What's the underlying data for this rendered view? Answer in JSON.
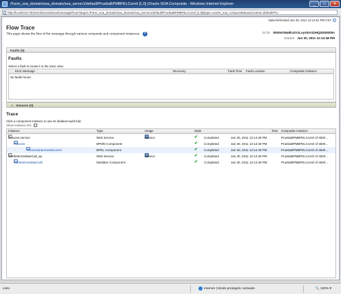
{
  "window": {
    "title": "/Farm_soa_domain/soa_domain/soa_server1/default/PruebaBPMBPELCorrel [1.0] (Oracle SOA Composite - Windows Internet Explorer",
    "minimize": "_",
    "maximize": "□",
    "close": "✕"
  },
  "address": {
    "url": "http://localhost:7001/em/faces/ai/soa/messageFlow?target=/Farm_soa_domain/soa_domain/soa_server1/default/PruebaBPMBPELCorrel [1.0]&type=oracle_soa_composite&soaContext=default/Pru"
  },
  "header": {
    "refresh_label": "Data Refreshed Jan 30, 2011 12:14:51 PM CST",
    "title": "Flow Trace",
    "description": "This page shows the flow of the message through various composite and component instances.",
    "help": "?",
    "ecid_label": "ECID",
    "ecid_value": "0000IrO8a8hJ4YzLoyG0A1DHQ2D00000n",
    "started_label": "Started",
    "started_value": "Jan 30, 2011 12:14:48 PM"
  },
  "faults": {
    "bar_label": "Faults (0)",
    "heading": "Faults",
    "hint": "Select a fault to locate it in the trace view.",
    "columns": [
      "Error Message",
      "Recovery",
      "Fault Time",
      "Fault Location",
      "Composite Instance"
    ],
    "empty": "No faults found"
  },
  "sensors": {
    "bar_label": "Sensors (0)"
  },
  "trace": {
    "heading": "Trace",
    "hint": "Click a component instance to see its detailed audit trail.",
    "show_ids": "Show Instance IDs",
    "columns": [
      "Instance",
      "Type",
      "Usage",
      "State",
      "Time",
      "Composite Instance"
    ],
    "rows": [
      {
        "instance": "Process.service",
        "type": "Web Service",
        "usage": "Service",
        "state": "Completed",
        "time": "Jan 30, 2011 12:14:48 PM",
        "composite": "PruebaBPMBPELCorrel of 4500..."
      },
      {
        "instance": "Process",
        "type": "BPMN Component",
        "usage": "",
        "state": "Completed",
        "time": "Jan 30, 2011 12:14:49 PM",
        "composite": "PruebaBPMBPELCorrel of 4500..."
      },
      {
        "instance": "*ProcessIntermedioCorrel",
        "type": "BPEL Component",
        "usage": "",
        "state": "Completed",
        "time": "Jan 30, 2011 12:14:49 PM",
        "composite": "PruebaBPMBPELCorrel of 4500..."
      },
      {
        "instance": "MedIntermediateCall_ep",
        "type": "Web Service",
        "usage": "Service",
        "state": "Completed",
        "time": "Jan 30, 2011 12:14:49 PM",
        "composite": "PruebaBPMBPELCorrel of 4500..."
      },
      {
        "instance": "MedIntermediateCall",
        "type": "Mediator Component",
        "usage": "",
        "state": "Completed",
        "time": "Jan 30, 2011 12:14:49 PM",
        "composite": "PruebaBPMBPELCorrel of 4500..."
      }
    ]
  },
  "status": {
    "left": "Listo",
    "zone": "Internet | Modo protegido: activado",
    "zoom": "100%"
  }
}
